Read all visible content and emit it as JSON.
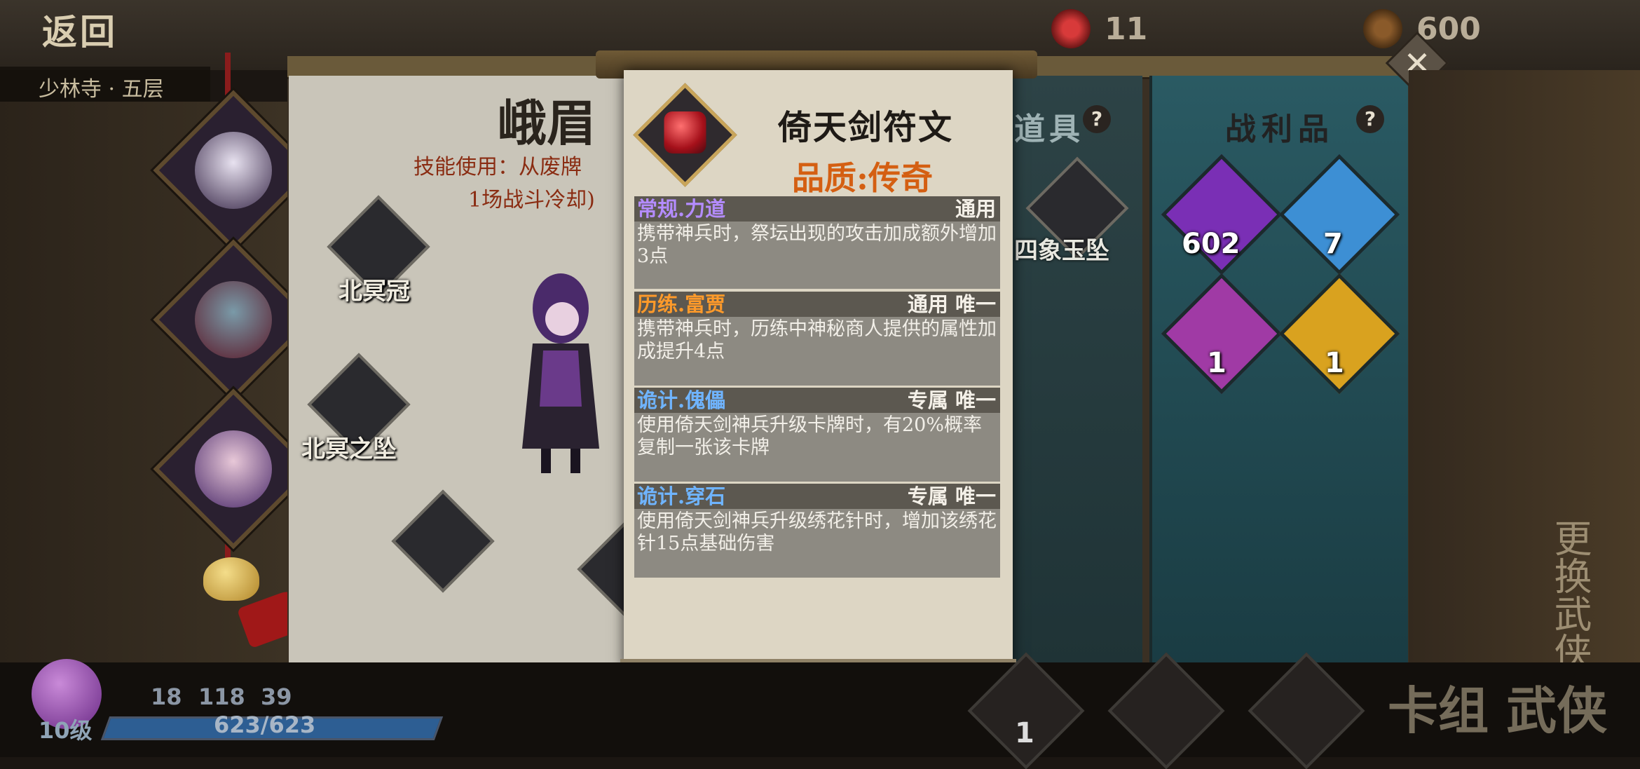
{
  "header": {
    "back_label": "返回",
    "location": "少林寺 · 五层",
    "currency_1": "11",
    "currency_2": "600",
    "currency_1_icon": "red-token-icon",
    "currency_2_icon": "copper-coin-icon"
  },
  "character_panel": {
    "name": "峨眉",
    "skill_line_1": "技能使用：从废牌",
    "skill_line_2": "1场战斗冷却)",
    "items": [
      "北冥冠",
      "北冥之坠"
    ]
  },
  "popup": {
    "title": "倚天剑符文",
    "quality": "品质:传奇",
    "accent_color": "#d45f12",
    "sections": [
      {
        "name": "常规.力道",
        "name_color": "#b48cff",
        "tag": "通用",
        "body": "携带神兵时，祭坛出现的攻击加成额外增加3点"
      },
      {
        "name": "历练.富贾",
        "name_color": "#ff9a2a",
        "tag": "通用 唯一",
        "body": "携带神兵时，历练中神秘商人提供的属性加成提升4点"
      },
      {
        "name": "诡计.傀儡",
        "name_color": "#6fb4ff",
        "tag": "专属 唯一",
        "body": "使用倚天剑神兵升级卡牌时，有20%概率复制一张该卡牌"
      },
      {
        "name": "诡计.穿石",
        "name_color": "#6fb4ff",
        "tag": "专属 唯一",
        "body": "使用倚天剑神兵升级绣花针时，增加该绣花针15点基础伤害"
      }
    ]
  },
  "items_panel": {
    "label": "道具",
    "item_name": "四象玉坠",
    "help_icon": "?"
  },
  "loot_panel": {
    "label": "战利品",
    "help_icon": "?",
    "loot": [
      {
        "count": "602",
        "color": "#7a2fb5"
      },
      {
        "count": "7",
        "color": "#3d8fd4"
      },
      {
        "count": "1",
        "color": "#a03aa5"
      },
      {
        "count": "1",
        "color": "#d9a21f"
      }
    ]
  },
  "player": {
    "level": "10级",
    "stat_1": "18",
    "stat_2": "118",
    "stat_3": "39",
    "hp": "623/623",
    "hp_fraction": 1.0
  },
  "bottom": {
    "card_count": "1",
    "deco_right": "更换武侠",
    "deco_bottom": "卡组 武侠"
  }
}
